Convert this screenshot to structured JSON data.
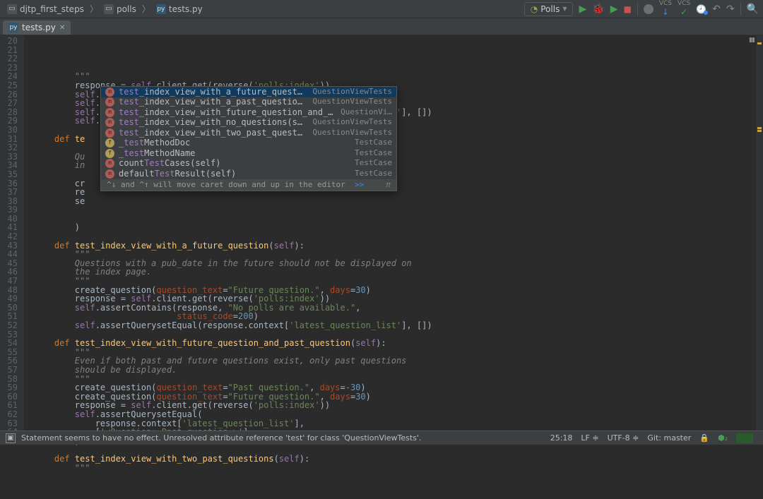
{
  "breadcrumb": [
    {
      "icon": "folder",
      "label": "djtp_first_steps"
    },
    {
      "icon": "folder",
      "label": "polls"
    },
    {
      "icon": "py",
      "label": "tests.py"
    }
  ],
  "run_config": {
    "icon": "test",
    "label": "Polls"
  },
  "tab": {
    "label": "tests.py"
  },
  "line_start": 20,
  "line_end": 64,
  "code_rows": [
    {
      "t": "doc",
      "txt": "        \"\"\""
    },
    {
      "t": "code",
      "txt": "        response = <p>self</p>.client.get(reverse(<s>'polls:index'</s>))"
    },
    {
      "t": "code",
      "txt": "        <p>self</p>.assertEqual(response.status_code, <n>200</n>)"
    },
    {
      "t": "code",
      "txt": "        <p>self</p>.assertContains(response, <s>\"No polls are available.\"</s>)"
    },
    {
      "t": "code",
      "txt": "        <p>self</p>.assertQuerysetEqual(response.context[<s>'latest_question_list'</s>], [])"
    },
    {
      "t": "code",
      "txt": "        <p>self</p>.test<caret>"
    },
    {
      "t": "blank",
      "txt": ""
    },
    {
      "t": "code",
      "txt": "    <k>def</k> <fn>te</fn>"
    },
    {
      "t": "dochide",
      "txt": ""
    },
    {
      "t": "doc",
      "txt": "        Qu"
    },
    {
      "t": "doc",
      "txt": "        in"
    },
    {
      "t": "dochide",
      "txt": ""
    },
    {
      "t": "code",
      "txt": "        cr"
    },
    {
      "t": "code",
      "txt": "        re"
    },
    {
      "t": "code",
      "txt": "        se"
    },
    {
      "t": "code",
      "txt": "          "
    },
    {
      "t": "code",
      "txt": "          "
    },
    {
      "t": "code",
      "txt": "        )"
    },
    {
      "t": "blank",
      "txt": ""
    },
    {
      "t": "code",
      "txt": "    <k>def</k> <fn>test_index_view_with_a_future_question</fn>(<p>self</p>):"
    },
    {
      "t": "doc",
      "txt": "        \"\"\""
    },
    {
      "t": "doc",
      "txt": "        Questions with a pub_date in the future should not be displayed on"
    },
    {
      "t": "doc",
      "txt": "        the index page."
    },
    {
      "t": "doc",
      "txt": "        \"\"\""
    },
    {
      "t": "code",
      "txt": "        create_question(<kw>question_text</kw>=<s>\"Future question.\"</s>, <kw>days</kw>=<n>30</n>)"
    },
    {
      "t": "code",
      "txt": "        response = <p>self</p>.client.get(reverse(<s>'polls:index'</s>))"
    },
    {
      "t": "code",
      "txt": "        <p>self</p>.assertContains(response, <s>\"No polls are available.\"</s>,"
    },
    {
      "t": "code",
      "txt": "                            <kw>status_code</kw>=<n>200</n>)"
    },
    {
      "t": "code",
      "txt": "        <p>self</p>.assertQuerysetEqual(response.context[<s>'latest_question_list'</s>], [])"
    },
    {
      "t": "blank",
      "txt": ""
    },
    {
      "t": "code",
      "txt": "    <k>def</k> <fn>test_index_view_with_future_question_and_past_question</fn>(<p>self</p>):"
    },
    {
      "t": "doc",
      "txt": "        \"\"\""
    },
    {
      "t": "doc",
      "txt": "        Even if both past and future questions exist, only past questions"
    },
    {
      "t": "doc",
      "txt": "        should be displayed."
    },
    {
      "t": "doc",
      "txt": "        \"\"\""
    },
    {
      "t": "code",
      "txt": "        create_question(<kw>question_text</kw>=<s>\"Past question.\"</s>, <kw>days</kw>=<n>-30</n>)"
    },
    {
      "t": "code",
      "txt": "        create_question(<kw>question_text</kw>=<s>\"Future question.\"</s>, <kw>days</kw>=<n>30</n>)"
    },
    {
      "t": "code",
      "txt": "        response = <p>self</p>.client.get(reverse(<s>'polls:index'</s>))"
    },
    {
      "t": "code",
      "txt": "        <p>self</p>.assertQuerysetEqual("
    },
    {
      "t": "code",
      "txt": "            response.context[<s>'latest_question_list'</s>],"
    },
    {
      "t": "code",
      "txt": "            [<s>'&lt;Question: Past question.&gt;'</s>]"
    },
    {
      "t": "code",
      "txt": "        )"
    },
    {
      "t": "blank",
      "txt": ""
    },
    {
      "t": "code",
      "txt": "    <k>def</k> <fn>test_index_view_with_two_past_questions</fn>(<p>self</p>):"
    },
    {
      "t": "doc",
      "txt": "        \"\"\""
    }
  ],
  "popup": {
    "items": [
      {
        "ic": "m",
        "pre": "test",
        "rest": "_index_view_with_a_future_question(self)",
        "cls": "QuestionViewTests",
        "sel": true
      },
      {
        "ic": "m",
        "pre": "test",
        "rest": "_index_view_with_a_past_question(self)",
        "cls": "QuestionViewTests"
      },
      {
        "ic": "m",
        "pre": "test",
        "rest": "_index_view_with_future_question_and_past_question",
        "cls": "QuestionVi…"
      },
      {
        "ic": "m",
        "pre": "test",
        "rest": "_index_view_with_no_questions(self)",
        "cls": "QuestionViewTests"
      },
      {
        "ic": "m",
        "pre": "test",
        "rest": "_index_view_with_two_past_questions(self)",
        "cls": "QuestionViewTests"
      },
      {
        "ic": "f",
        "prefix": "_",
        "pre": "test",
        "rest": "MethodDoc",
        "cls": "TestCase"
      },
      {
        "ic": "f",
        "prefix": "_",
        "pre": "test",
        "rest": "MethodName",
        "cls": "TestCase"
      },
      {
        "ic": "m",
        "prefix": "count",
        "pre": "Test",
        "rest": "Cases(self)",
        "cls": "TestCase"
      },
      {
        "ic": "m",
        "prefix": "default",
        "pre": "Test",
        "rest": "Result(self)",
        "cls": "TestCase"
      }
    ],
    "hint": {
      "text": "^↓ and ^↑ will move caret down and up in the editor  ",
      "link": ">>",
      "pi": "π"
    }
  },
  "status": {
    "msg": "Statement seems to have no effect. Unresolved attribute reference 'test' for class 'QuestionViewTests'.",
    "pos": "25:18",
    "line_sep": "LF",
    "enc": "UTF-8",
    "git": "Git: master",
    "lock": "🔒"
  }
}
